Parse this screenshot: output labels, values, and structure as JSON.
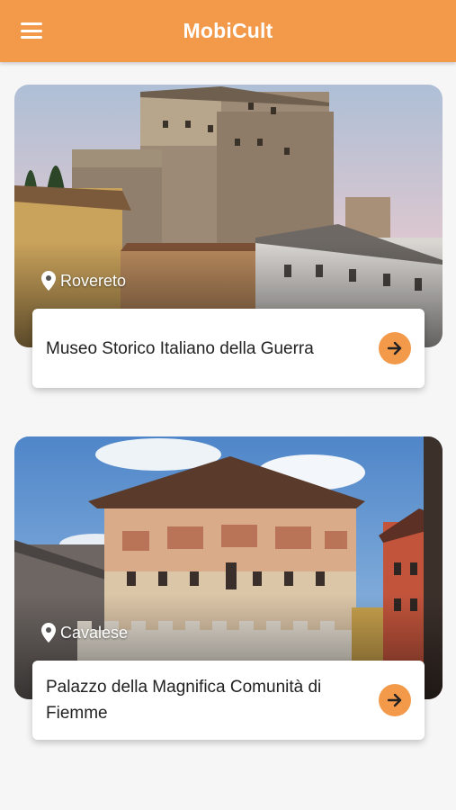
{
  "app": {
    "title": "MobiCult",
    "menu_icon": "hamburger-menu-icon",
    "accent": "#f2994a"
  },
  "cards": [
    {
      "location": "Rovereto",
      "name": "Museo Storico Italiano della Guerra",
      "pin_icon": "location-pin-icon",
      "action_icon": "arrow-right-icon"
    },
    {
      "location": "Cavalese",
      "name": "Palazzo della Magnifica Comunità di Fiemme",
      "pin_icon": "location-pin-icon",
      "action_icon": "arrow-right-icon"
    }
  ]
}
